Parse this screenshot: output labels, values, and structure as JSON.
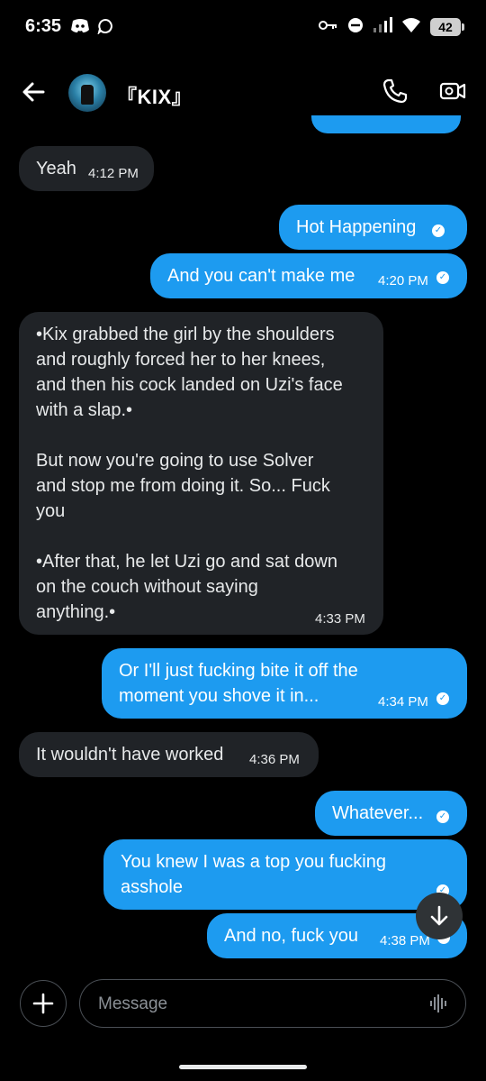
{
  "status_bar": {
    "time": "6:35",
    "battery": "42"
  },
  "header": {
    "contact_name": "『KIX』"
  },
  "messages": [
    {
      "dir": "in",
      "text": "Yeah",
      "time": "4:12 PM"
    },
    {
      "dir": "out",
      "text": "Hot Happening",
      "time": ""
    },
    {
      "dir": "out",
      "text": "And you can't make me",
      "time": "4:20 PM"
    },
    {
      "dir": "in",
      "text": "•Kix grabbed the girl by the shoulders\nand roughly forced her to her knees,\nand then his cock landed on Uzi's face\nwith a slap.•\n\nBut now you're going to use Solver\nand stop me from doing it. So... Fuck\nyou\n\n•After that, he let Uzi go and sat down\non the couch without saying\nanything.•",
      "time": "4:33 PM"
    },
    {
      "dir": "out",
      "text": "Or I'll just fucking bite it off the\nmoment you shove it in...",
      "time": "4:34 PM"
    },
    {
      "dir": "in",
      "text": "It wouldn't have worked",
      "time": "4:36 PM"
    },
    {
      "dir": "out",
      "text": "Whatever...",
      "time": ""
    },
    {
      "dir": "out",
      "text": "You knew I was a top you fucking\nasshole",
      "time": ""
    },
    {
      "dir": "out",
      "text": "And no, fuck you",
      "time": "4:38 PM"
    }
  ],
  "composer": {
    "placeholder": "Message"
  },
  "colors": {
    "outgoing_bubble": "#1d9bf0",
    "incoming_bubble": "#202327",
    "background": "#000000"
  },
  "icons": [
    "back-arrow-icon",
    "phone-icon",
    "video-call-icon",
    "scroll-down-arrow-icon",
    "plus-icon",
    "voice-wave-icon"
  ]
}
